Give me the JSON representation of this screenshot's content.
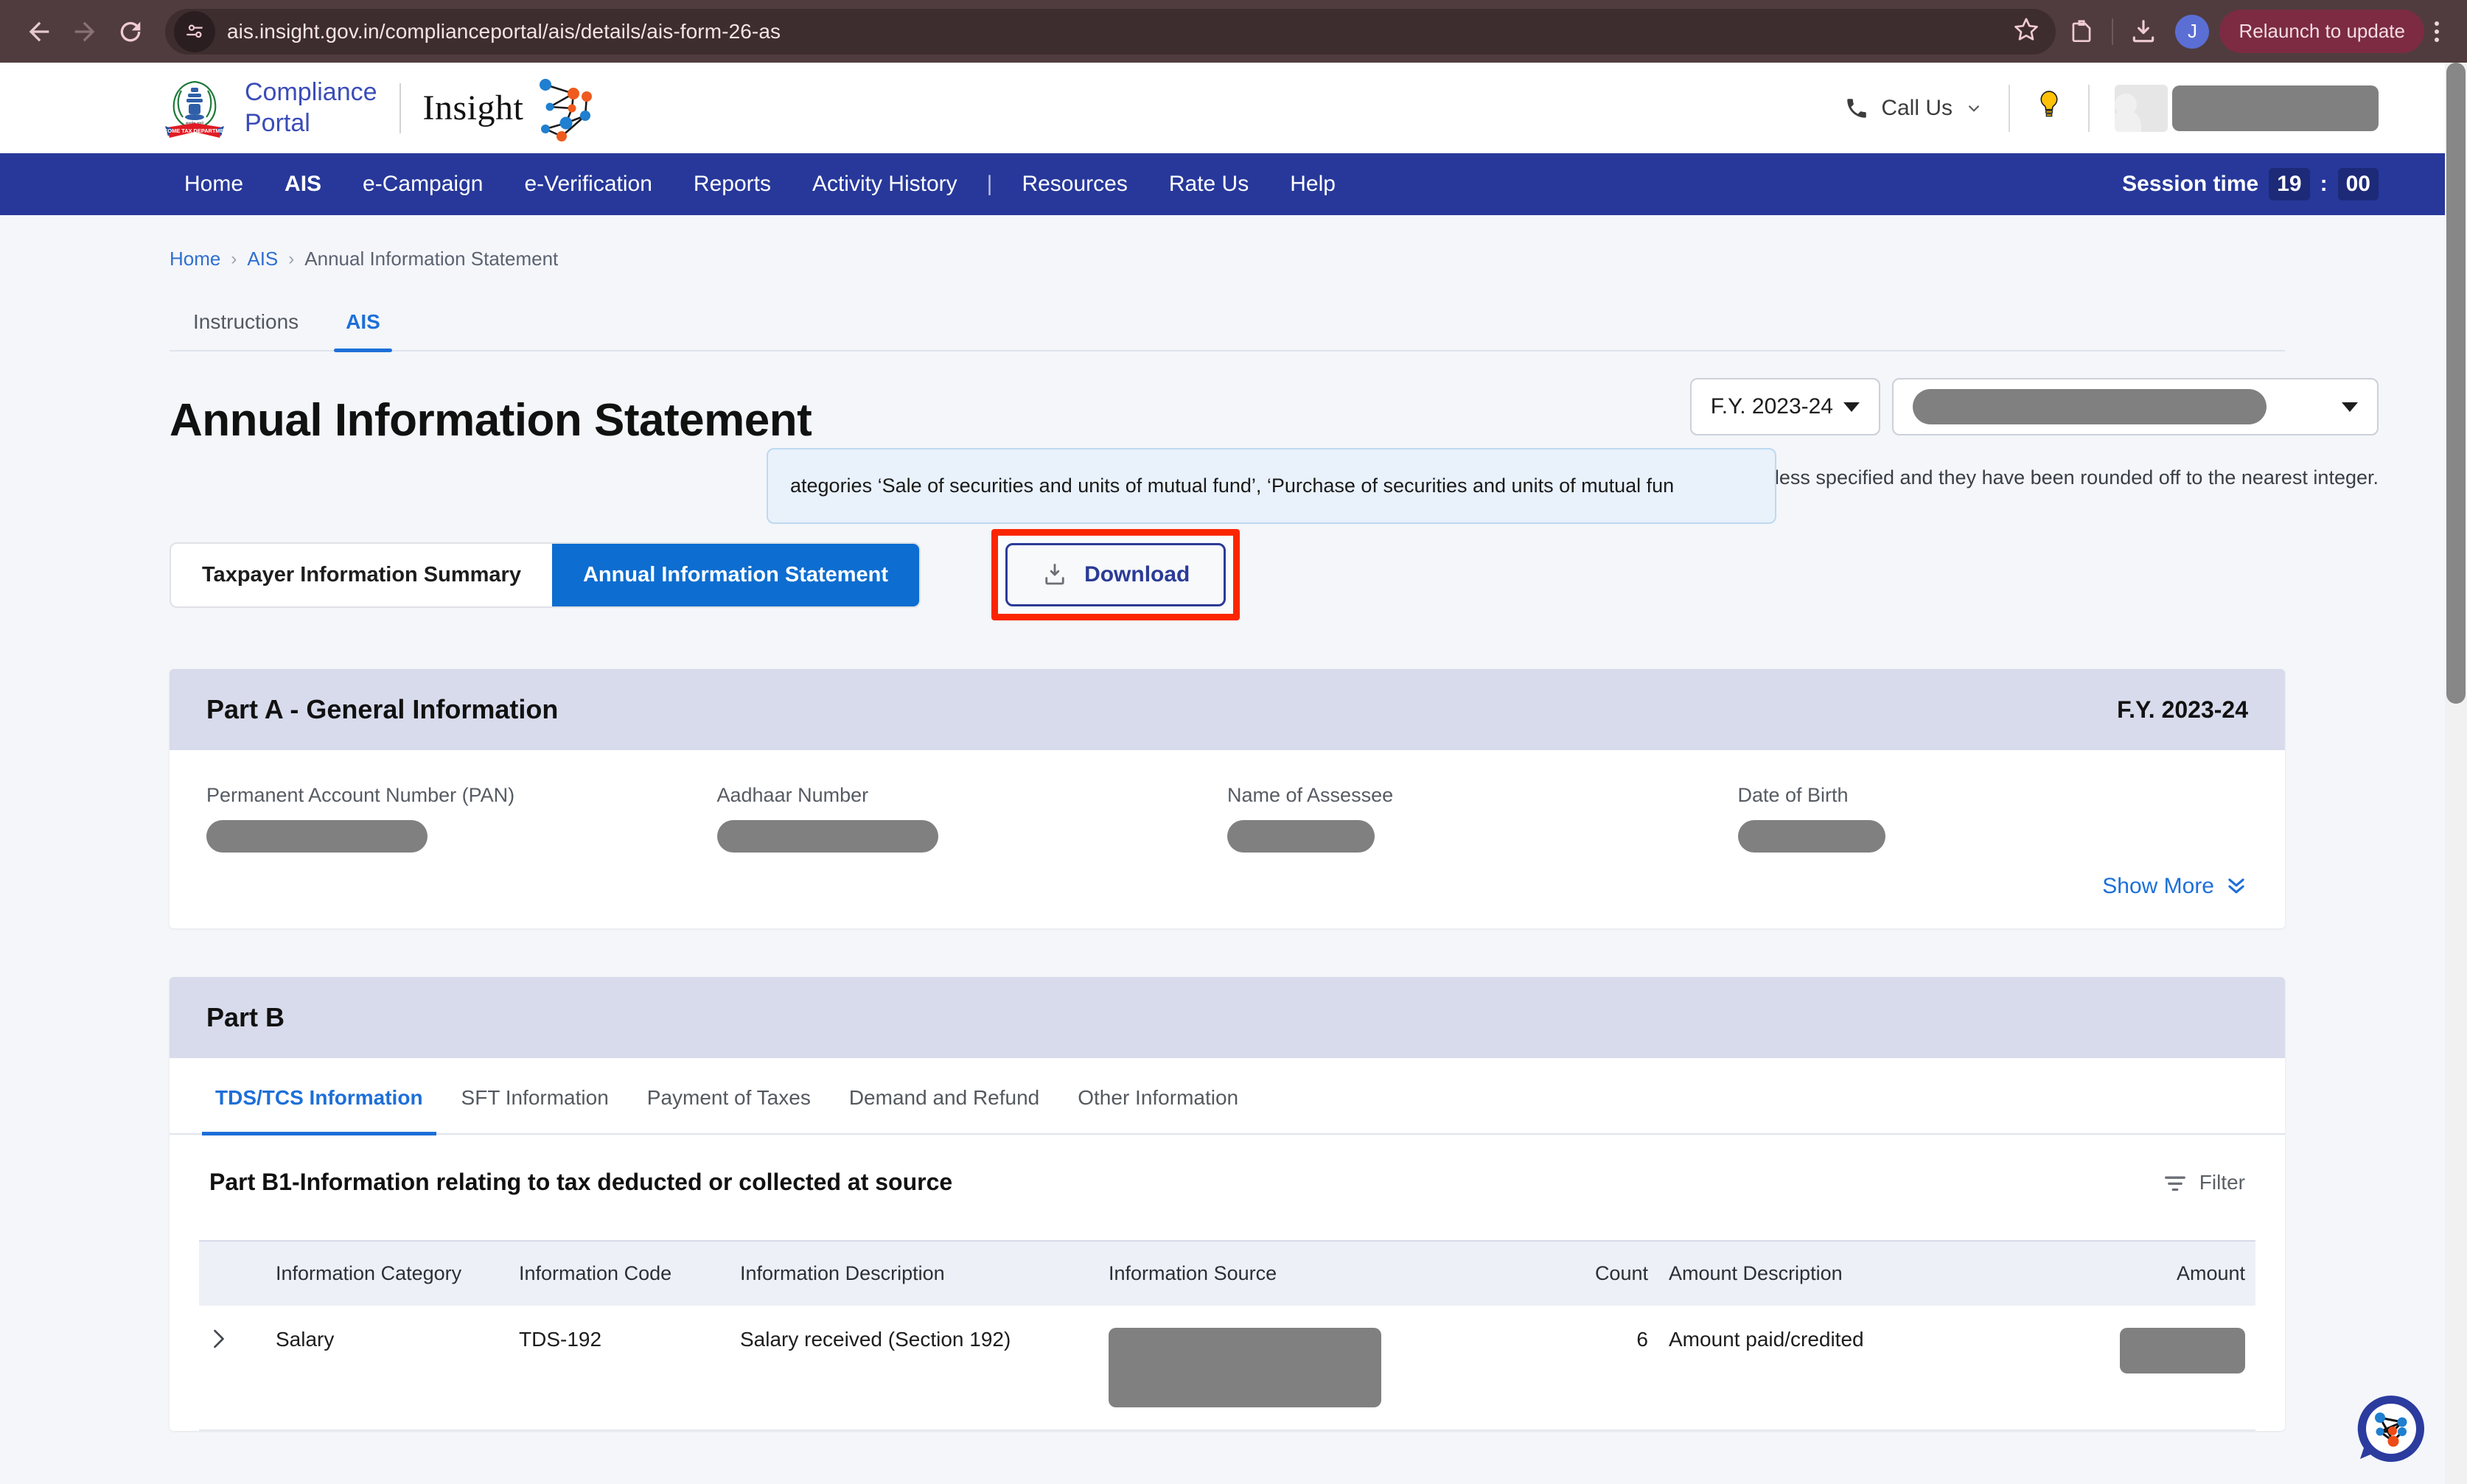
{
  "browser": {
    "back_icon": "back-arrow-icon",
    "forward_icon": "forward-arrow-icon",
    "reload_icon": "reload-icon",
    "site_settings_icon": "site-settings-icon",
    "url": "ais.insight.gov.in/complianceportal/ais/details/ais-form-26-as",
    "bookmark_icon": "star-icon",
    "extensions_icon": "extensions-icon",
    "downloads_icon": "downloads-icon",
    "profile_initial": "J",
    "relaunch_label": "Relaunch to update",
    "menu_icon": "kebab-menu-icon"
  },
  "header": {
    "brand_line1": "Compliance",
    "brand_line2": "Portal",
    "insight_label": "Insight",
    "call_us_label": "Call Us",
    "bulb_icon": "lightbulb-icon",
    "avatar_icon": "user-avatar",
    "user_name": ""
  },
  "nav": {
    "items": [
      {
        "label": "Home",
        "active": false
      },
      {
        "label": "AIS",
        "active": true
      },
      {
        "label": "e-Campaign",
        "active": false
      },
      {
        "label": "e-Verification",
        "active": false
      },
      {
        "label": "Reports",
        "active": false
      },
      {
        "label": "Activity History",
        "active": false
      },
      {
        "label": "Resources",
        "active": false
      },
      {
        "label": "Rate Us",
        "active": false
      },
      {
        "label": "Help",
        "active": false
      }
    ],
    "separator": "|",
    "session_label": "Session time",
    "session_minutes": "19",
    "session_colon": ":",
    "session_seconds": "00"
  },
  "breadcrumb": {
    "home": "Home",
    "ais": "AIS",
    "current": "Annual Information Statement",
    "sep": "›"
  },
  "tooltip": {
    "text": "ategories ‘Sale of securities and units of mutual fund’, ‘Purchase of securities and units of mutual fun"
  },
  "subtabs": [
    {
      "label": "Instructions",
      "active": false
    },
    {
      "label": "AIS",
      "active": true
    }
  ],
  "main": {
    "title": "Annual Information Statement",
    "fy_selected": "F.Y. 2023-24",
    "assessee_value": "",
    "inr_note": "All values are in INR unless specified and they have been rounded off to the nearest integer.",
    "segment": [
      {
        "label": "Taxpayer Information Summary",
        "active": false
      },
      {
        "label": "Annual Information Statement",
        "active": true
      }
    ],
    "download_label": "Download",
    "download_icon": "download-icon",
    "highlight_color": "#fb2600"
  },
  "part_a": {
    "title": "Part A - General Information",
    "fy": "F.Y. 2023-24",
    "fields": [
      {
        "label": "Permanent Account Number (PAN)",
        "value": ""
      },
      {
        "label": "Aadhaar Number",
        "value": ""
      },
      {
        "label": "Name of Assessee",
        "value": ""
      },
      {
        "label": "Date of Birth",
        "value": ""
      }
    ],
    "show_more_label": "Show More",
    "show_more_icon": "chevron-double-down-icon"
  },
  "part_b": {
    "title": "Part B",
    "tabs": [
      {
        "label": "TDS/TCS Information",
        "active": true
      },
      {
        "label": "SFT Information",
        "active": false
      },
      {
        "label": "Payment of Taxes",
        "active": false
      },
      {
        "label": "Demand and Refund",
        "active": false
      },
      {
        "label": "Other Information",
        "active": false
      }
    ],
    "b1_title": "Part B1-Information relating to tax deducted or collected at source",
    "filter_label": "Filter",
    "filter_icon": "filter-icon",
    "table": {
      "columns": [
        "",
        "Information Category",
        "Information Code",
        "Information Description",
        "Information Source",
        "Count",
        "Amount Description",
        "Amount"
      ],
      "rows": [
        {
          "expand_icon": "chevron-right-icon",
          "category": "Salary",
          "code": "TDS-192",
          "description": "Salary received (Section 192)",
          "source": "",
          "count": "6",
          "amount_description": "Amount paid/credited",
          "amount": ""
        }
      ]
    }
  },
  "chat": {
    "icon": "insight-chat-bubble-icon"
  }
}
